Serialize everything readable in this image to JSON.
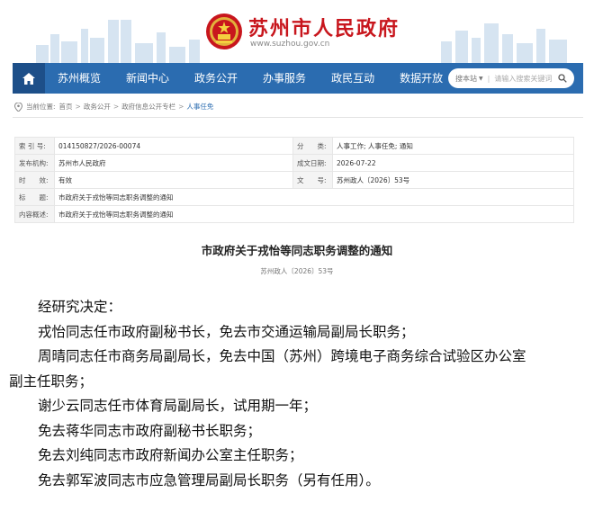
{
  "header": {
    "site_title": "苏州市人民政府",
    "site_domain": "www.suzhou.gov.cn"
  },
  "nav": {
    "items": [
      "苏州概览",
      "新闻中心",
      "政务公开",
      "办事服务",
      "政民互动",
      "数据开放"
    ],
    "search_type": "搜本站",
    "search_placeholder": "请输入搜索关键词"
  },
  "breadcrumb": {
    "label": "当前位置:",
    "items": [
      "首页",
      "政务公开",
      "政府信息公开专栏",
      "人事任免"
    ]
  },
  "meta": {
    "index_key": "索 引 号:",
    "index_val": "014150827/2026-00074",
    "category_key": "分　　类:",
    "category_val": "人事工作;  人事任免;  通知",
    "issuer_key": "发布机构:",
    "issuer_val": "苏州市人民政府",
    "date_key": "成文日期:",
    "date_val": "2026-07-22",
    "validity_key": "时　　效:",
    "validity_val": "有效",
    "docno_key": "文　　号:",
    "docno_val": "苏州政人〔2026〕53号",
    "title_key": "标　　题:",
    "title_val": "市政府关于戎怡等同志职务调整的通知",
    "summary_key": "内容概述:",
    "summary_val": "市政府关于戎怡等同志职务调整的通知"
  },
  "article": {
    "title": "市政府关于戎怡等同志职务调整的通知",
    "doc_number": "苏州政人〔2026〕53号",
    "lines": [
      "经研究决定：",
      "戎怡同志任市政府副秘书长，免去市交通运输局副局长职务；",
      "周晴同志任市商务局副局长，免去中国（苏州）跨境电子商务综合试验区办公室",
      "副主任职务；",
      "谢少云同志任市体育局副局长，试用期一年；",
      "免去蒋华同志市政府副秘书长职务；",
      "免去刘纯同志市政府新闻办公室主任职务；",
      "免去郭军波同志市应急管理局副局长职务（另有任用）。"
    ]
  },
  "colors": {
    "nav_bg": "#2b6cb0",
    "nav_home_bg": "#1d4f89",
    "title_red": "#c8161d"
  }
}
